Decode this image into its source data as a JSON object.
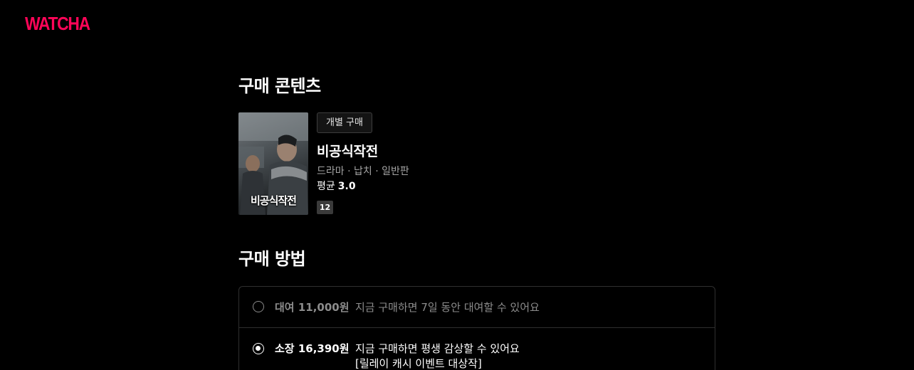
{
  "brand": {
    "logo_text": "WATCHA",
    "accent_color": "#ff0558"
  },
  "content_section": {
    "title": "구매 콘텐츠"
  },
  "product": {
    "purchase_type_badge": "개별 구매",
    "title": "비공식작전",
    "poster_title": "비공식작전",
    "meta": "드라마 · 납치 · 일반판",
    "rating_label": "평균",
    "rating_value": "3.0",
    "age_rating": "12"
  },
  "method_section": {
    "title": "구매 방법"
  },
  "options": [
    {
      "label": "대여 11,000원",
      "description": "지금 구매하면 7일 동안 대여할 수 있어요",
      "selected": false
    },
    {
      "label": "소장 16,390원",
      "description": "지금 구매하면 평생 감상할 수 있어요",
      "event": "[릴레이 캐시 이벤트 대상작]",
      "selected": true
    }
  ]
}
